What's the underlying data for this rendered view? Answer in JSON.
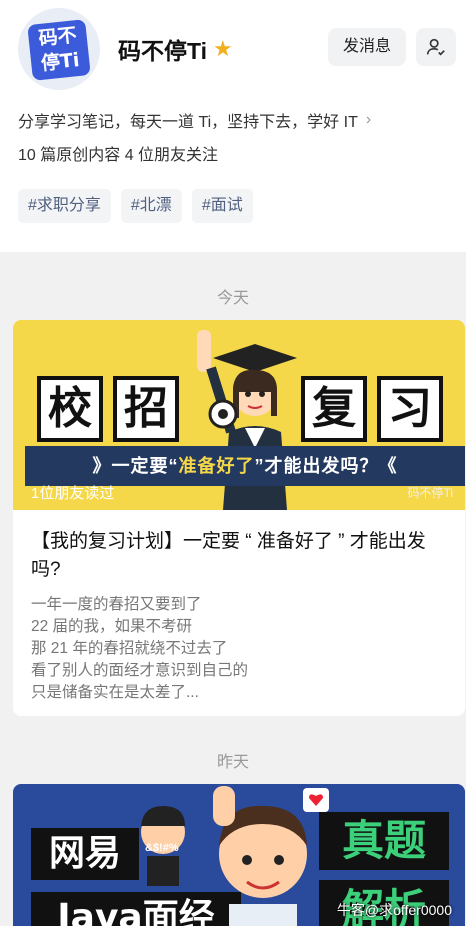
{
  "profile": {
    "avatar_text_line1": "码不",
    "avatar_text_line2": "停Ti",
    "name": "码不停Ti",
    "badge_icon": "star-icon",
    "message_button": "发消息",
    "follow_icon": "user-check-icon",
    "bio": "分享学习笔记，每天一道 Ti，坚持下去，学好 IT",
    "stats": "10 篇原创内容  4 位朋友关注",
    "tags": [
      "#求职分享",
      "#北漂",
      "#面试"
    ]
  },
  "sections": [
    {
      "day": "今天",
      "card": {
        "cover_boxes_left": [
          "校",
          "招"
        ],
        "cover_boxes_right": [
          "复",
          "习"
        ],
        "cover_ribbon_prefix": "》一定要“",
        "cover_ribbon_highlight": "准备好了",
        "cover_ribbon_suffix": "”才能出发吗？《",
        "readers": "1位朋友读过",
        "watermark": "码不停Ti",
        "title": "【我的复习计划】一定要 “ 准备好了 ” 才能出发吗?",
        "summary": [
          "一年一度的春招又要到了",
          "22 届的我，如果不考研",
          "那 21 年的春招就绕不过去了",
          "看了别人的面经才意识到自己的",
          "只是储备实在是太差了..."
        ]
      }
    },
    {
      "day": "昨天",
      "card": {
        "cover_words": [
          "网易",
          "Java面经",
          "真题",
          "解析"
        ],
        "cover_bubble": "&$!#%"
      }
    }
  ],
  "footer_watermark": "牛客@求offer0000",
  "colors": {
    "accent": "#3b5bdb",
    "tag_text": "#506080",
    "cover_yellow": "#f5d84a",
    "ribbon_navy": "#24395f",
    "cover_blue": "#2a4a9c",
    "green": "#3cd07a"
  }
}
